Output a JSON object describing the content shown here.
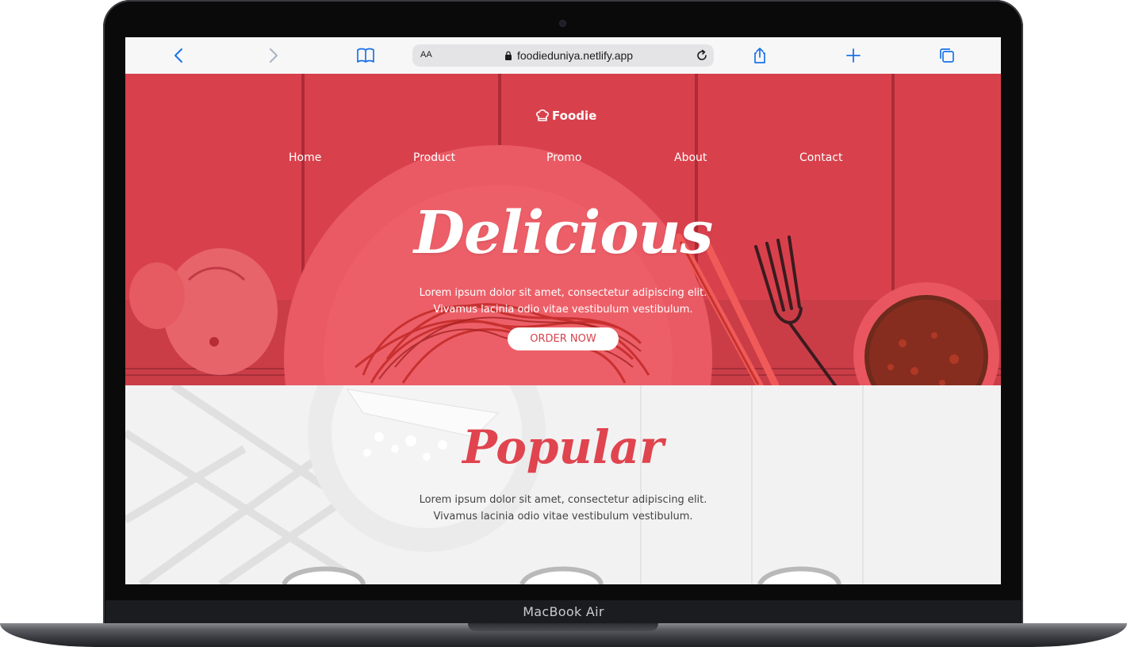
{
  "device": {
    "label": "MacBook Air"
  },
  "browser": {
    "back_icon": "chevron-left-icon",
    "forward_icon": "chevron-right-icon",
    "bookmarks_icon": "book-icon",
    "text_size_label": "AA",
    "url": "foodieduniya.netlify.app",
    "share_icon": "share-icon",
    "new_tab_icon": "plus-icon",
    "tabs_icon": "tabs-icon",
    "accent": "#1a73e8"
  },
  "site": {
    "logo_text": "Foodie",
    "nav": [
      "Home",
      "Product",
      "Promo",
      "About",
      "Contact"
    ],
    "hero": {
      "title": "Delicious",
      "text_line1": "Lorem ipsum dolor sit amet, consectetur adipiscing elit.",
      "text_line2": "Vivamus lacinia odio vitae vestibulum vestibulum.",
      "button": "ORDER NOW"
    },
    "popular": {
      "title": "Popular",
      "text_line1": "Lorem ipsum dolor sit amet, consectetur adipiscing elit.",
      "text_line2": "Vivamus lacinia odio vitae vestibulum vestibulum."
    },
    "colors": {
      "brand": "#d8414c",
      "title_red": "#e0444f"
    }
  }
}
